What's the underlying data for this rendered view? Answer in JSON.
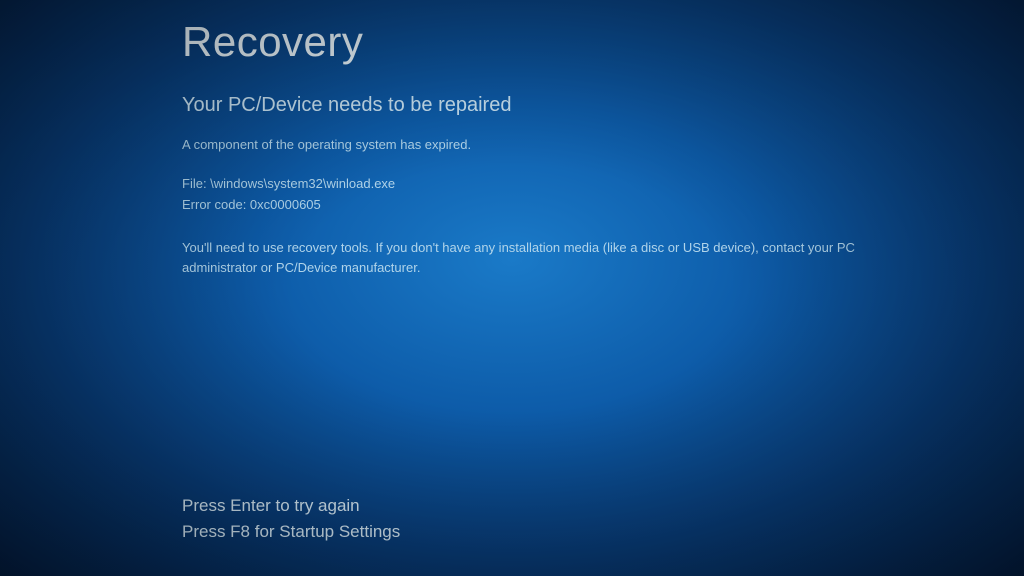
{
  "recovery": {
    "title": "Recovery",
    "subtitle": "Your PC/Device needs to be repaired",
    "description": "A component of the operating system has expired.",
    "file_label": "File: \\windows\\system32\\winload.exe",
    "error_label": "Error code: 0xc0000605",
    "instructions": "You'll need to use recovery tools. If you don't have any installation media (like a disc or USB device), contact your PC administrator or PC/Device manufacturer.",
    "action_enter": "Press Enter to try again",
    "action_f8": "Press F8 for Startup Settings"
  }
}
